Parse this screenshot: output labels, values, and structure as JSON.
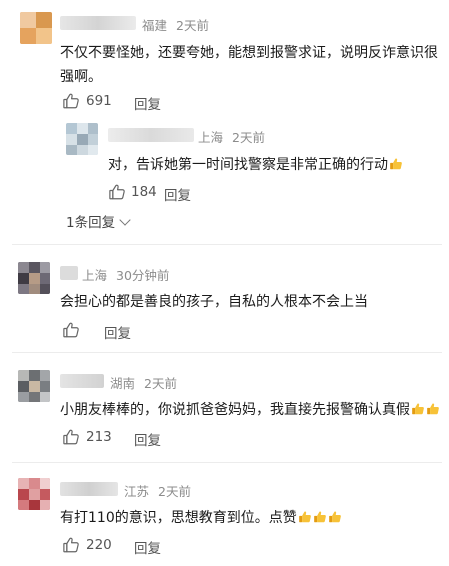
{
  "comments": [
    {
      "location": "福建",
      "time": "2天前",
      "text": "不仅不要怪她，还要夸她，能想到报警求证，说明反诈意识很强啊。",
      "likes": "691",
      "reply_label": "回复",
      "sub_reply": {
        "location": "上海",
        "time": "2天前",
        "text": "对，告诉她第一时间找警察是非常正确的行动",
        "likes": "184",
        "reply_label": "回复"
      },
      "more_replies": "1条回复"
    },
    {
      "location": "上海",
      "time": "30分钟前",
      "text": "会担心的都是善良的孩子，自私的人根本不会上当",
      "likes": "0",
      "reply_label": "回复"
    },
    {
      "location": "湖南",
      "time": "2天前",
      "text": "小朋友棒棒的，你说抓爸爸妈妈，我直接先报警确认真假",
      "likes": "213",
      "reply_label": "回复"
    },
    {
      "location": "江苏",
      "time": "2天前",
      "text": "有打110的意识，思想教育到位。点赞",
      "likes": "220",
      "reply_label": "回复"
    }
  ],
  "icons": {
    "like": "thumbs-up-outline-icon",
    "emoji": "thumbs-up-emoji-icon",
    "chevron": "chevron-down-icon"
  },
  "colors": {
    "meta": "#8c8c8c",
    "text": "#1a1a1a",
    "separator": "#ececec",
    "emoji": "#f2b31b"
  }
}
